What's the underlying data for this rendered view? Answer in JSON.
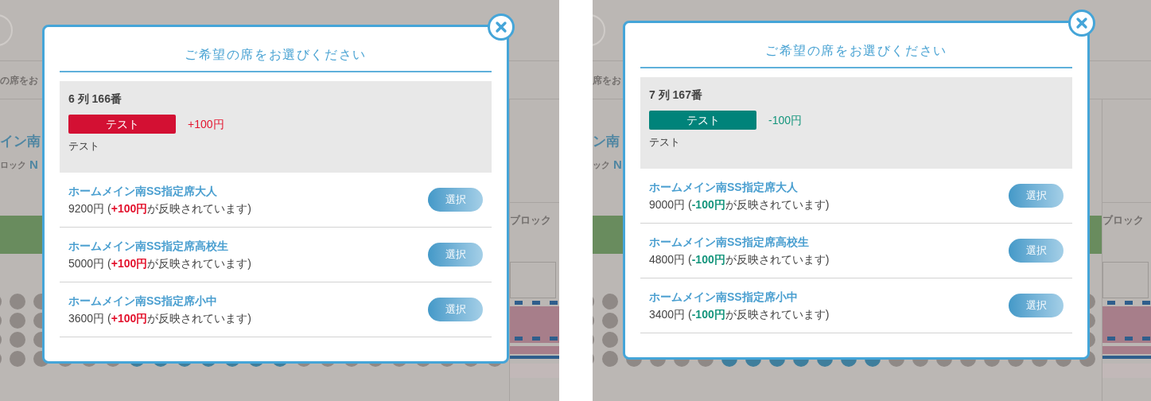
{
  "panels": [
    {
      "background": {
        "header_text": "の席をお",
        "venue_text": "イン南",
        "block_text": "ロック",
        "block_letter": "N",
        "side_text": "ブロック"
      },
      "modal": {
        "title": "ご希望の席をお選びください",
        "seat": "6 列 166番",
        "tag": {
          "label": "テスト",
          "color": "#d31033"
        },
        "adjustment": {
          "text": "+100円",
          "color": "#e3132d"
        },
        "description": "テスト",
        "tickets": [
          {
            "name": "ホームメイン南SS指定席大人",
            "price": "9200円 (**+100円**が反映されています)",
            "button": "選択"
          },
          {
            "name": "ホームメイン南SS指定席高校生",
            "price": "5000円 (**+100円**が反映されています)",
            "button": "選択"
          },
          {
            "name": "ホームメイン南SS指定席小中",
            "price": "3600円 (**+100円**が反映されています)",
            "button": "選択"
          }
        ]
      }
    },
    {
      "background": {
        "header_text": "席をお",
        "venue_text": "ン南",
        "block_text": "ック",
        "block_letter": "N",
        "side_text": "ブロック"
      },
      "modal": {
        "title": "ご希望の席をお選びください",
        "seat": "7 列 167番",
        "tag": {
          "label": "テスト",
          "color": "#00837a"
        },
        "adjustment": {
          "text": "-100円",
          "color": "#14957c"
        },
        "description": "テスト",
        "tickets": [
          {
            "name": "ホームメイン南SS指定席大人",
            "price": "9000円 (**-100円**が反映されています)",
            "button": "選択"
          },
          {
            "name": "ホームメイン南SS指定席高校生",
            "price": "4800円 (**-100円**が反映されています)",
            "button": "選択"
          },
          {
            "name": "ホームメイン南SS指定席小中",
            "price": "3400円 (**-100円**が反映されています)",
            "button": "選択"
          }
        ]
      }
    }
  ]
}
